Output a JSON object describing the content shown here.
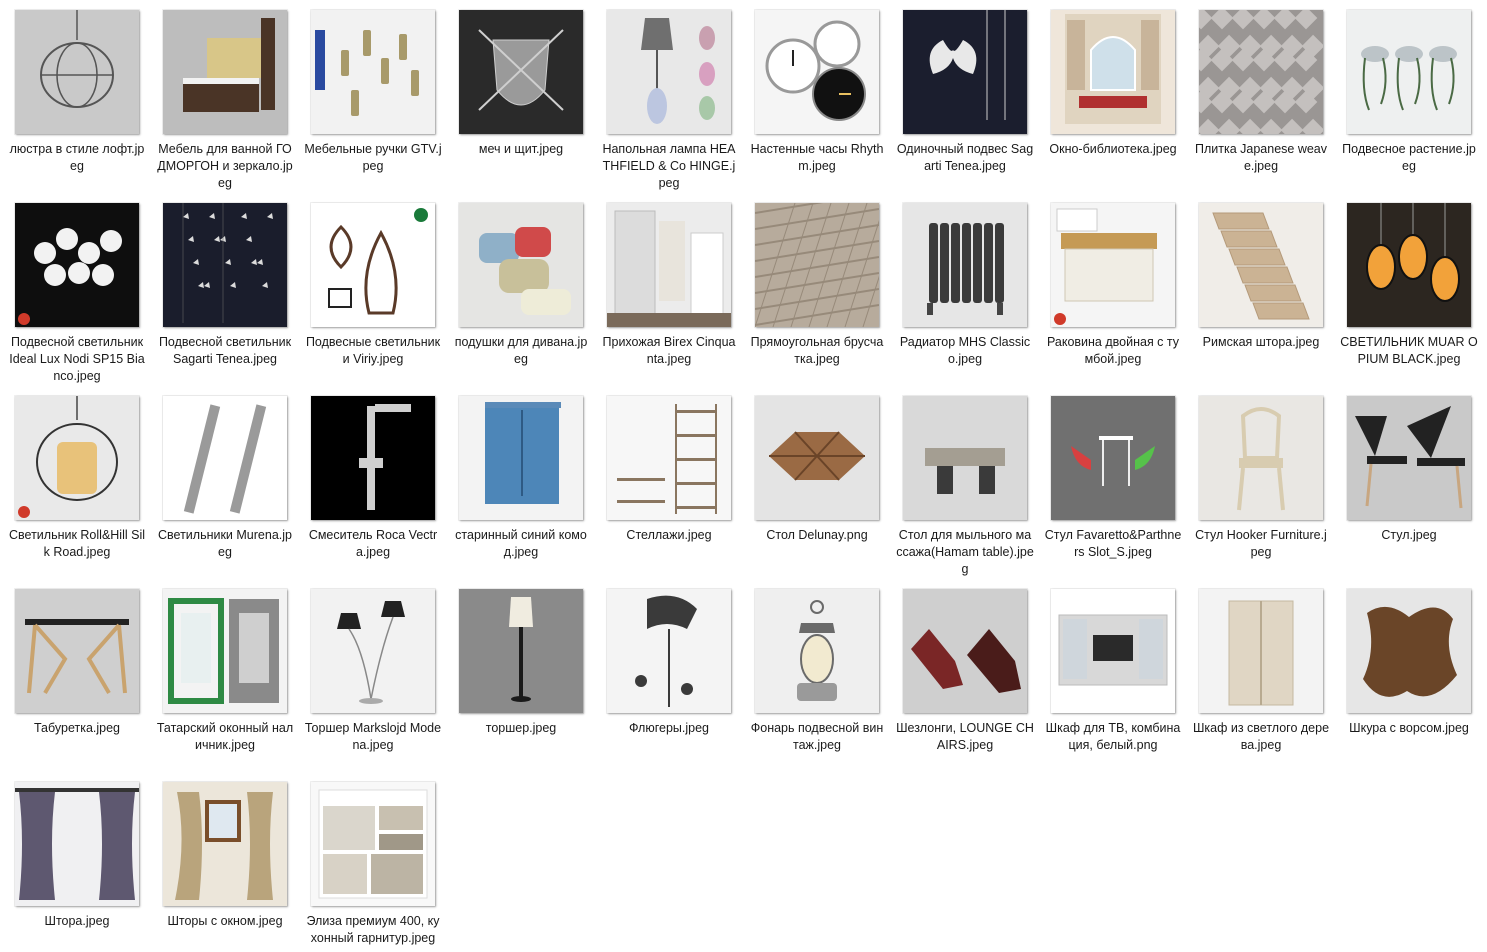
{
  "explorer": {
    "files": [
      {
        "name": "люстра в стиле лофт.jpeg",
        "icon": "chandelier-thumbnail",
        "bg": "#c9c9c9",
        "fg": "#555555",
        "shape": "chandelier"
      },
      {
        "name": "Мебель для ванной ГОДМОРГОН и зеркало.jpeg",
        "icon": "bathroom-furniture-thumbnail",
        "bg": "#bdbdbd",
        "fg": "#4a3426",
        "shape": "cabinet"
      },
      {
        "name": "Мебельные ручки GTV.jpeg",
        "icon": "furniture-handles-thumbnail",
        "bg": "#f2f2f2",
        "fg": "#a89a6a",
        "shape": "handles"
      },
      {
        "name": "меч и щит.jpeg",
        "icon": "sword-shield-thumbnail",
        "bg": "#2a2a2a",
        "fg": "#9a9a9a",
        "shape": "shield"
      },
      {
        "name": "Напольная лампа HEATHFIELD & Co HINGE.jpeg",
        "icon": "floor-lamp-thumbnail",
        "bg": "#e8e8e8",
        "fg": "#8a8a8a",
        "shape": "lamp"
      },
      {
        "name": "Настенные часы Rhythm.jpeg",
        "icon": "wall-clocks-thumbnail",
        "bg": "#f5f5f5",
        "fg": "#222222",
        "shape": "clocks"
      },
      {
        "name": "Одиночный подвес Sagarti Tenea.jpeg",
        "icon": "pendant-thumbnail",
        "bg": "#1b1e2e",
        "fg": "#e8e8e8",
        "shape": "butterfly"
      },
      {
        "name": "Окно-библиотека.jpeg",
        "icon": "window-library-thumbnail",
        "bg": "#efe6da",
        "fg": "#b03030",
        "shape": "window"
      },
      {
        "name": "Плитка Japanese weave.jpeg",
        "icon": "tile-thumbnail",
        "bg": "#9a9694",
        "fg": "#c4c0be",
        "shape": "weave"
      },
      {
        "name": "Подвесное растение.jpeg",
        "icon": "hanging-plant-thumbnail",
        "bg": "#eef0f0",
        "fg": "#4a6a44",
        "shape": "plants"
      },
      {
        "name": "Подвесной светильник Ideal Lux Nodi SP15 Bianco.jpeg",
        "icon": "pendant-light-thumbnail",
        "bg": "#0e0e0e",
        "fg": "#f2f2f2",
        "shape": "bubbles"
      },
      {
        "name": "Подвесной светильник Sagarti Tenea.jpeg",
        "icon": "pendant-light-thumbnail",
        "bg": "#1a1d2c",
        "fg": "#dcdcdc",
        "shape": "butterflies"
      },
      {
        "name": "Подвесные светильники Viriy.jpeg",
        "icon": "pendant-lights-thumbnail",
        "bg": "#ffffff",
        "fg": "#5a3a28",
        "shape": "vases"
      },
      {
        "name": "подушки для дивана.jpeg",
        "icon": "pillows-thumbnail",
        "bg": "#e5e5e3",
        "fg": "#c8c0a4",
        "shape": "pillows"
      },
      {
        "name": "Прихожая Birex Cinquanta.jpeg",
        "icon": "hallway-thumbnail",
        "bg": "#ececec",
        "fg": "#7a6a5a",
        "shape": "hallway"
      },
      {
        "name": "Прямоугольная брусчатка.jpeg",
        "icon": "paving-thumbnail",
        "bg": "#b7ab9c",
        "fg": "#978a7a",
        "shape": "paving"
      },
      {
        "name": "Радиатор MHS Classico.jpeg",
        "icon": "radiator-thumbnail",
        "bg": "#e6e6e6",
        "fg": "#3a3a3a",
        "shape": "radiator"
      },
      {
        "name": "Раковина двойная с тумбой.jpeg",
        "icon": "double-sink-thumbnail",
        "bg": "#f5f5f5",
        "fg": "#c59a55",
        "shape": "sink"
      },
      {
        "name": "Римская штора.jpeg",
        "icon": "roman-blind-thumbnail",
        "bg": "#f0ede8",
        "fg": "#cbb394",
        "shape": "blind"
      },
      {
        "name": "СВЕТИЛЬНИК MUAR OPIUM BLACK.jpeg",
        "icon": "lamps-thumbnail",
        "bg": "#2c2620",
        "fg": "#f2a23a",
        "shape": "lanterns"
      },
      {
        "name": "Светильник Roll&Hill Silk Road.jpeg",
        "icon": "light-thumbnail",
        "bg": "#e9e9e9",
        "fg": "#e8c27a",
        "shape": "drum"
      },
      {
        "name": "Светильники Murena.jpeg",
        "icon": "lights-thumbnail",
        "bg": "#ffffff",
        "fg": "#9a9a9a",
        "shape": "tubes"
      },
      {
        "name": "Смеситель Roca Vectra.jpeg",
        "icon": "shower-mixer-thumbnail",
        "bg": "#000000",
        "fg": "#cfcfcf",
        "shape": "shower"
      },
      {
        "name": "старинный синий комод.jpeg",
        "icon": "blue-dresser-thumbnail",
        "bg": "#f3f3f3",
        "fg": "#4d86b8",
        "shape": "dresser"
      },
      {
        "name": "Стеллажи.jpeg",
        "icon": "shelves-thumbnail",
        "bg": "#f7f7f7",
        "fg": "#8a7660",
        "shape": "shelves"
      },
      {
        "name": "Стол Delunay.png",
        "icon": "table-thumbnail",
        "bg": "#e4e4e4",
        "fg": "#9a6a44",
        "shape": "woodtable"
      },
      {
        "name": "Стол для мыльного массажа(Hamam table).jpeg",
        "icon": "hamam-table-thumbnail",
        "bg": "#d9d9d9",
        "fg": "#a49e92",
        "shape": "hamam"
      },
      {
        "name": "Стул Favaretto&Parthners Slot_S.jpeg",
        "icon": "chairs-thumbnail",
        "bg": "#707070",
        "fg": "#d84040",
        "shape": "slotchairs"
      },
      {
        "name": "Стул Hooker Furniture.jpeg",
        "icon": "chair-thumbnail",
        "bg": "#e9e7e3",
        "fg": "#d8ccb0",
        "shape": "hooker"
      },
      {
        "name": "Стул.jpeg",
        "icon": "chair-thumbnail",
        "bg": "#c9c9c9",
        "fg": "#c8a680",
        "shape": "chair"
      },
      {
        "name": "Табуретка.jpeg",
        "icon": "stool-thumbnail",
        "bg": "#cfcfcf",
        "fg": "#c9a36e",
        "shape": "stool"
      },
      {
        "name": "Татарский оконный наличник.jpeg",
        "icon": "window-frame-thumbnail",
        "bg": "#f3f3f3",
        "fg": "#2e8a44",
        "shape": "frames"
      },
      {
        "name": "Торшер Markslojd Modena.jpeg",
        "icon": "floor-lamp-thumbnail",
        "bg": "#f2f2f2",
        "fg": "#222222",
        "shape": "torch2"
      },
      {
        "name": "торшер.jpeg",
        "icon": "floor-lamp-thumbnail",
        "bg": "#8a8a8a",
        "fg": "#f0ece0",
        "shape": "torch"
      },
      {
        "name": "Флюгеры.jpeg",
        "icon": "weathervane-thumbnail",
        "bg": "#f4f4f4",
        "fg": "#3a3a3a",
        "shape": "vane"
      },
      {
        "name": "Фонарь подвесной винтаж.jpeg",
        "icon": "lantern-thumbnail",
        "bg": "#efefef",
        "fg": "#6a6a6a",
        "shape": "lantern"
      },
      {
        "name": "Шезлонги, LOUNGE CHAIRS.jpeg",
        "icon": "lounge-chairs-thumbnail",
        "bg": "#cfcfcf",
        "fg": "#7a2626",
        "shape": "lounge"
      },
      {
        "name": "Шкаф для ТВ, комбинация, белый.png",
        "icon": "tv-cabinet-thumbnail",
        "bg": "#ffffff",
        "fg": "#d8d8d8",
        "shape": "tvunit"
      },
      {
        "name": "Шкаф из светлого дерева.jpeg",
        "icon": "wardrobe-thumbnail",
        "bg": "#f3f3f3",
        "fg": "#e0d6c4",
        "shape": "wardrobe"
      },
      {
        "name": "Шкура с ворсом.jpeg",
        "icon": "fur-rug-thumbnail",
        "bg": "#e6e6e6",
        "fg": "#6a4528",
        "shape": "fur"
      },
      {
        "name": "Штора.jpeg",
        "icon": "curtain-thumbnail",
        "bg": "#f0f0f2",
        "fg": "#5e5870",
        "shape": "curtain"
      },
      {
        "name": "Шторы с окном.jpeg",
        "icon": "curtains-window-thumbnail",
        "bg": "#ece6da",
        "fg": "#b9a47c",
        "shape": "curtainwin"
      },
      {
        "name": "Элиза премиум 400, кухонный гарнитур.jpeg",
        "icon": "kitchen-thumbnail",
        "bg": "#f8f8f8",
        "fg": "#b0a89a",
        "shape": "kitchen"
      }
    ]
  }
}
